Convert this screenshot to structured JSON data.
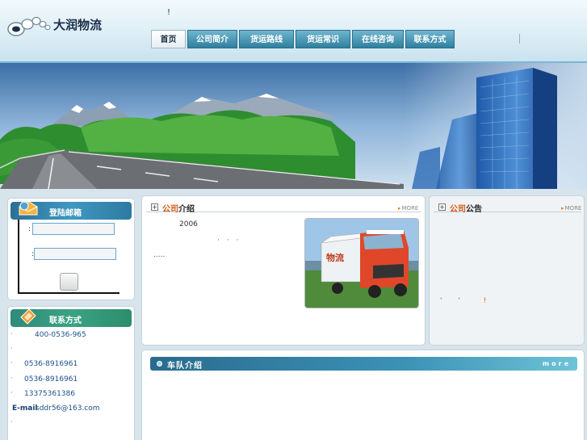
{
  "header": {
    "logo_text": "大润物流",
    "mark": "!"
  },
  "nav": {
    "tabs": [
      {
        "label": "首页",
        "active": true
      },
      {
        "label": "公司简介",
        "active": false
      },
      {
        "label": "货运路线",
        "active": false
      },
      {
        "label": "货运常识",
        "active": false
      },
      {
        "label": "在线咨询",
        "active": false
      },
      {
        "label": "联系方式",
        "active": false
      }
    ]
  },
  "login": {
    "title": "登陆邮箱",
    "colon1": ":",
    "colon2": ":"
  },
  "contact": {
    "title": "联系方式",
    "rows": [
      {
        "bullet": "·",
        "value": "400-0536-965"
      },
      {
        "bullet": "·",
        "value": ""
      },
      {
        "bullet": "·",
        "value": "0536-8916961"
      },
      {
        "bullet": "·",
        "value": "0536-8916961"
      },
      {
        "bullet": "·",
        "value": "13375361386"
      },
      {
        "label": "E-mail",
        "value": "sddr56@163.com"
      },
      {
        "bullet": "·",
        "value": ""
      }
    ]
  },
  "intro": {
    "title_highlight": "公司",
    "title_rest": "介绍",
    "more": "MORE",
    "year": "2006",
    "dots": "·  ·   ·",
    "ellipsis": "....."
  },
  "notice": {
    "title_highlight": "公司",
    "title_rest": "公告",
    "more": "MORE",
    "marks": "'       '          !"
  },
  "fleet": {
    "title": "车队介绍",
    "more": "more"
  },
  "colors": {
    "nav_blue": "#2f7f9e",
    "accent_orange": "#d35a10",
    "link_blue": "#1c4f8a"
  }
}
